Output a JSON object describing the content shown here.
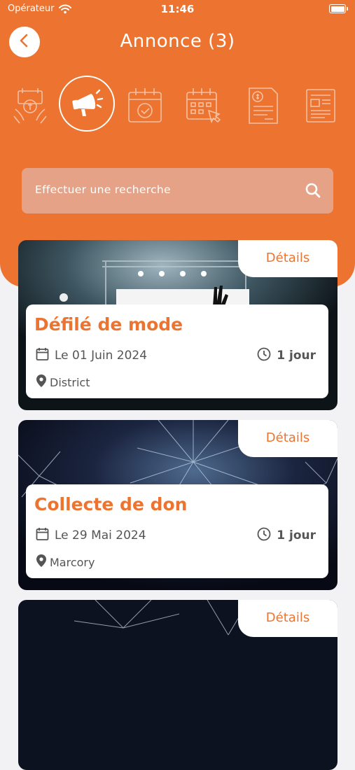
{
  "status_bar": {
    "carrier": "Opérateur",
    "time": "11:46"
  },
  "header": {
    "title": "Annonce (3)"
  },
  "categories": [
    {
      "icon": "charity-hands-icon",
      "active": false
    },
    {
      "icon": "megaphone-icon",
      "active": true
    },
    {
      "icon": "calendar-check-icon",
      "active": false
    },
    {
      "icon": "calendar-click-icon",
      "active": false
    },
    {
      "icon": "invoice-icon",
      "active": false
    },
    {
      "icon": "newspaper-icon",
      "active": false
    }
  ],
  "search": {
    "placeholder": "Effectuer une recherche"
  },
  "cards": [
    {
      "details_label": "Détails",
      "title": "Défilé de mode",
      "date": "Le 01 Juin 2024",
      "duration": "1 jour",
      "location": "District",
      "image": "concert-stage"
    },
    {
      "details_label": "Détails",
      "title": "Collecte de don",
      "date": "Le 29 Mai 2024",
      "duration": "1 jour",
      "location": "Marcory",
      "image": "fireworks"
    },
    {
      "details_label": "Détails",
      "image": "fireworks"
    }
  ],
  "colors": {
    "accent": "#EC7430",
    "background": "#F2F2F4"
  }
}
